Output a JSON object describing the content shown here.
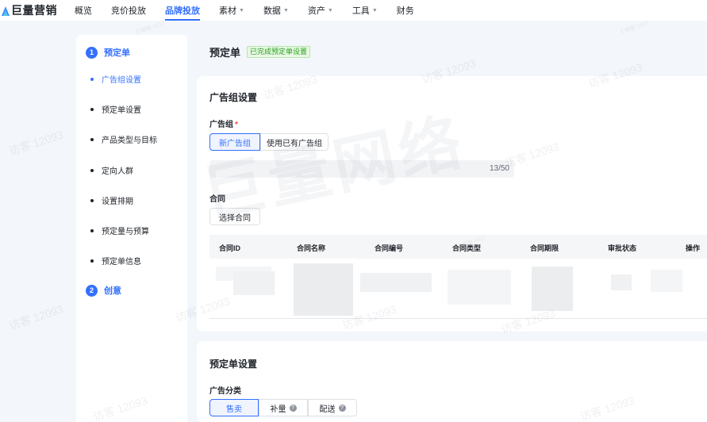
{
  "nav": {
    "logo": "巨量营销",
    "items": [
      {
        "label": "概览",
        "caret": false,
        "active": false
      },
      {
        "label": "竞价投放",
        "caret": false,
        "active": false
      },
      {
        "label": "品牌投放",
        "caret": false,
        "active": true
      },
      {
        "label": "素材",
        "caret": true,
        "active": false
      },
      {
        "label": "数据",
        "caret": true,
        "active": false
      },
      {
        "label": "资产",
        "caret": true,
        "active": false
      },
      {
        "label": "工具",
        "caret": true,
        "active": false
      },
      {
        "label": "财务",
        "caret": false,
        "active": false
      }
    ]
  },
  "steps": {
    "step1": {
      "num": "1",
      "title": "预定单"
    },
    "substeps": [
      "广告组设置",
      "预定单设置",
      "产品类型与目标",
      "定向人群",
      "设置排期",
      "预定量与预算",
      "预定单信息"
    ],
    "active_substep": 0,
    "step2": {
      "num": "2",
      "title": "创意"
    }
  },
  "page": {
    "title": "预定单",
    "status_badge": "已完成预定单设置"
  },
  "ad_group": {
    "section_title": "广告组设置",
    "field_label": "广告组",
    "required_mark": "*",
    "options": [
      "新广告组",
      "使用已有广告组"
    ],
    "selected": 0,
    "name_counter": "13/50"
  },
  "contract": {
    "field_label": "合同",
    "select_button": "选择合同",
    "columns": [
      "合同ID",
      "合同名称",
      "合同编号",
      "合同类型",
      "合同期限",
      "审批状态",
      "操作"
    ]
  },
  "order_settings": {
    "section_title": "预定单设置",
    "field_label": "广告分类",
    "options": [
      {
        "label": "售卖",
        "help": false
      },
      {
        "label": "补量",
        "help": true
      },
      {
        "label": "配送",
        "help": true
      }
    ],
    "selected": 0,
    "help_glyph": "?"
  },
  "watermark": {
    "brand": "巨量网络",
    "text": "访客 12093",
    "small": "王敏敏 1017"
  },
  "colors": {
    "accent": "#3370ff",
    "success": "#2ea121",
    "required": "#f54a45"
  }
}
